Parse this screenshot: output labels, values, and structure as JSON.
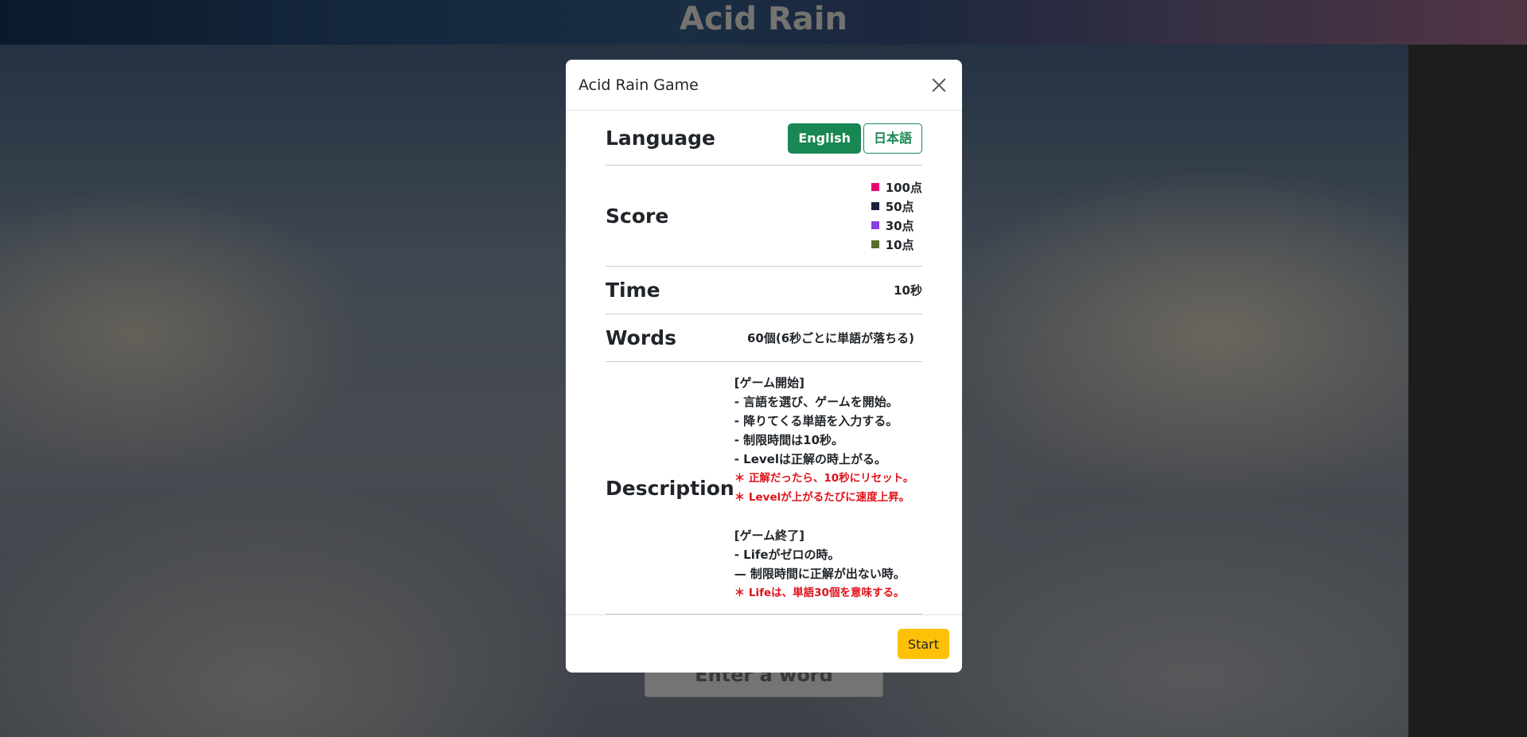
{
  "game": {
    "title": "Acid Rain",
    "input_placeholder": "Enter a word"
  },
  "modal": {
    "title": "Acid Rain Game",
    "language": {
      "label": "Language",
      "options": [
        "English",
        "日本語"
      ],
      "selected": "English"
    },
    "score": {
      "label": "Score",
      "items": [
        {
          "text": "100点",
          "color": "#e60073"
        },
        {
          "text": "50点",
          "color": "#1a1f3c"
        },
        {
          "text": "30点",
          "color": "#8a3fe0"
        },
        {
          "text": "10点",
          "color": "#5a6b2e"
        }
      ]
    },
    "time": {
      "label": "Time",
      "value": "10秒"
    },
    "words": {
      "label": "Words",
      "value": "60個(6秒ごとに単語が落ちる)"
    },
    "description": {
      "label": "Description",
      "start_heading": "[ゲーム開始]",
      "start_lines": [
        "- 言語を選び、ゲームを開始。",
        "- 降りてくる単語を入力する。",
        "- 制限時間は10秒。",
        "- Levelは正解の時上がる。"
      ],
      "start_notes": [
        "＊ 正解だったら、10秒にリセット。",
        "＊ Levelが上がるたびに速度上昇。"
      ],
      "end_heading": "[ゲーム終了]",
      "end_lines": [
        "- Lifeがゼロの時。",
        "— 制限時間に正解が出ない時。"
      ],
      "end_notes": [
        "＊ Lifeは、単語30個を意味する。"
      ]
    },
    "start_button": "Start"
  }
}
